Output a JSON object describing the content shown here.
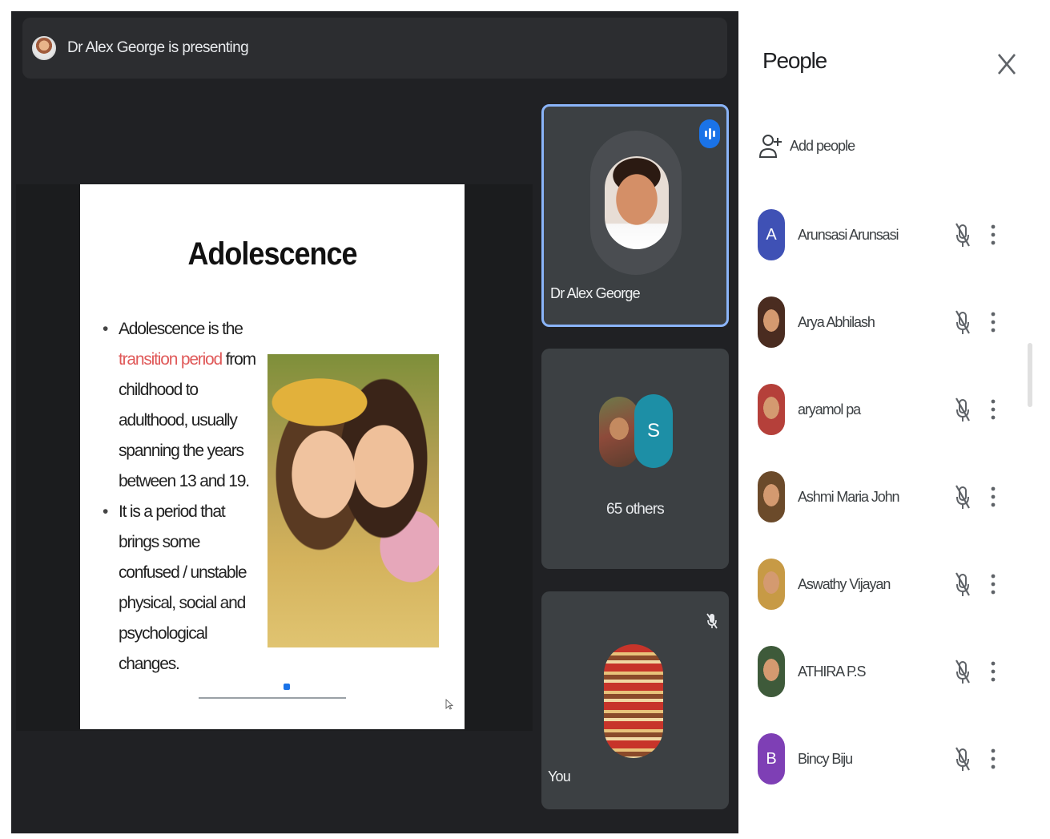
{
  "presenting": {
    "text": "Dr Alex George is presenting"
  },
  "slide": {
    "title": "Adolescence",
    "bullet1_pre": "Adolescence is the ",
    "bullet1_highlight": "transition period",
    "bullet1_post": " from childhood to adulthood, usually spanning the years between 13 and 19.",
    "bullet2": "It is a period that brings some confused / unstable physical, social and psychological changes."
  },
  "tiles": {
    "presenter_name": "Dr Alex George",
    "others_avatar_letter": "S",
    "others_count": "65 others",
    "you_label": "You"
  },
  "people_panel": {
    "title": "People",
    "add_people": "Add people",
    "participants": [
      {
        "name": "Arunsasi Arunsasi",
        "initial": "A",
        "avatar_color": "#3f51b5",
        "photo": false
      },
      {
        "name": "Arya Abhilash",
        "initial": "",
        "avatar_color": "#4a2c20",
        "photo": true
      },
      {
        "name": "aryamol pa",
        "initial": "",
        "avatar_color": "#b5403a",
        "photo": true
      },
      {
        "name": "Ashmi Maria John",
        "initial": "",
        "avatar_color": "#6b4a2a",
        "photo": true
      },
      {
        "name": "Aswathy Vijayan",
        "initial": "",
        "avatar_color": "#c79a45",
        "photo": true
      },
      {
        "name": "ATHIRA P.S",
        "initial": "",
        "avatar_color": "#3e5a3a",
        "photo": true
      },
      {
        "name": "Bincy Biju",
        "initial": "B",
        "avatar_color": "#7e3fb5",
        "photo": false
      }
    ]
  },
  "colors": {
    "accent": "#1a73e8",
    "stage_bg": "#202124",
    "tile_bg": "#3c4043",
    "highlight_text": "#e05a5a"
  },
  "icons": {
    "close": "close-icon",
    "add_person": "person-add-icon",
    "mic_off": "mic-off-icon",
    "more": "more-vert-icon",
    "speaking": "speaking-indicator-icon"
  }
}
